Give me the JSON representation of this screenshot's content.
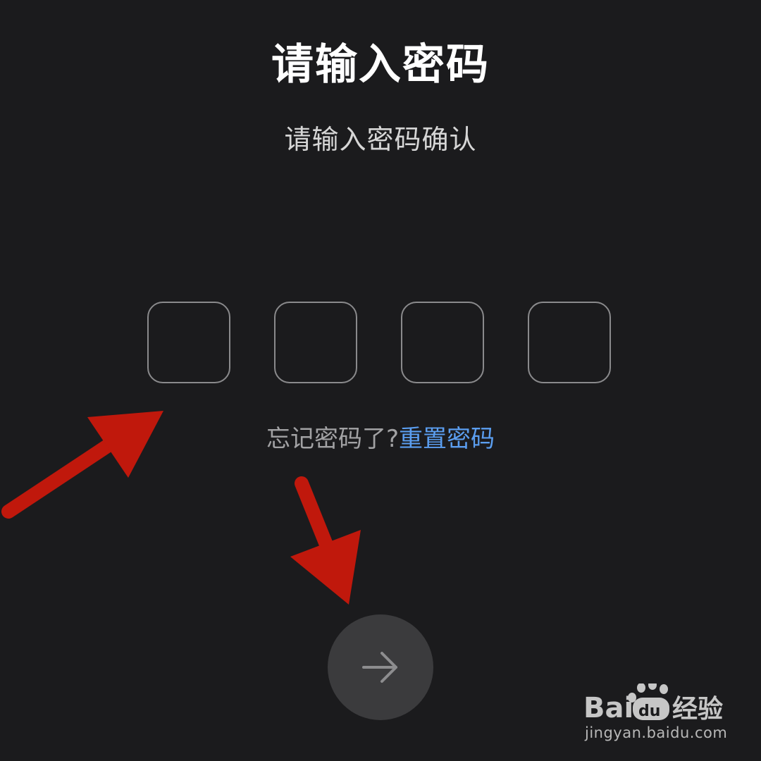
{
  "screen": {
    "title": "请输入密码",
    "subtitle": "请输入密码确认"
  },
  "pin": {
    "length": 4,
    "boxes": [
      "",
      "",
      "",
      ""
    ]
  },
  "forgot": {
    "prompt": "忘记密码了?",
    "reset_link": "重置密码"
  },
  "next_button": {
    "icon": "arrow-right-icon"
  },
  "watermark": {
    "logo_text": "Baidu经验",
    "domain": "jingyan.baidu.com"
  },
  "colors": {
    "background": "#1b1b1d",
    "link": "#5b9ef0",
    "annotation_arrow": "#c0180c"
  }
}
